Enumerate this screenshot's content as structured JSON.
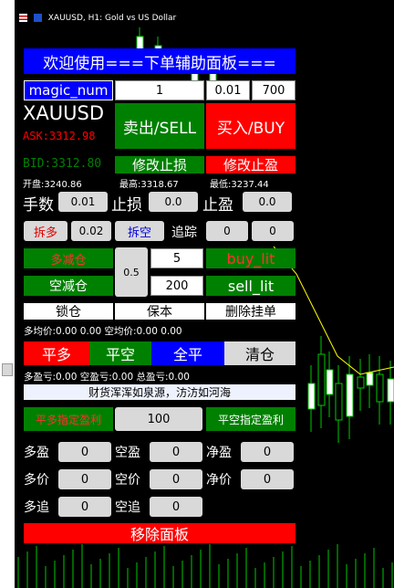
{
  "window": {
    "title": "XAUUSD, H1: Gold vs US Dollar"
  },
  "panel": {
    "header": "欢迎使用===下单辅助面板===",
    "magic_label": "magic_num",
    "magic_value": "1",
    "lot_value": "0.01",
    "points_value": "700",
    "symbol": "XAUUSD",
    "ask": "ASK:3312.98",
    "bid": "BID:3312.80",
    "sell_btn": "卖出/SELL",
    "buy_btn": "买入/BUY",
    "mod_sl_btn": "修改止损",
    "mod_tp_btn": "修改止盈",
    "open_price": "开盘:3240.86",
    "high_price": "最高:3318.67",
    "low_price": "最低:3237.44",
    "lots_label": "手数",
    "lots_value": "0.01",
    "sl_label": "止损",
    "sl_value": "0.0",
    "tp_label": "止盈",
    "tp_value": "0.0",
    "split_long_btn": "拆多",
    "split_value": "0.02",
    "split_short_btn": "拆空",
    "trail_label": "追踪",
    "trail_value_1": "0",
    "trail_value_2": "0",
    "reduce_long_btn": "多减仓",
    "reduce_short_btn": "空减仓",
    "reduce_ratio": "0.5",
    "reduce_value_1": "5",
    "reduce_value_2": "200",
    "buy_limit_btn": "buy_lit",
    "sell_limit_btn": "sell_lit",
    "lock_btn": "锁仓",
    "breakeven_btn": "保本",
    "delete_pending_btn": "删除挂单",
    "avg_line": "多均价:0.00  0.00 空均价:0.00  0.00",
    "close_long_btn": "平多",
    "close_short_btn": "平空",
    "close_all_btn": "全平",
    "clear_btn": "清仓",
    "pl_line": "多盈亏:0.00  空盈亏:0.00 总盈亏:0.00",
    "slogan": "财货浑浑如泉源，汸汸如河海",
    "long_tp_btn": "平多指定盈利",
    "tp_target_value": "100",
    "short_tp_btn": "平空指定盈利",
    "long_profit_label": "多盈",
    "long_profit_value": "0",
    "short_profit_label": "空盈",
    "short_profit_value": "0",
    "net_profit_label": "净盈",
    "net_profit_value": "0",
    "long_price_label": "多价",
    "long_price_value": "0",
    "short_price_label": "空价",
    "short_price_value": "0",
    "net_price_label": "净价",
    "net_price_value": "0",
    "long_trail_label": "多追",
    "long_trail_value": "0",
    "short_trail_label": "空追",
    "short_trail_value": "0",
    "remove_panel_btn": "移除面板"
  },
  "colors": {
    "red": "#ff0000",
    "green": "#008000",
    "blue": "#0000ff",
    "bid_green": "#008000",
    "ask_red": "#ff0000"
  }
}
